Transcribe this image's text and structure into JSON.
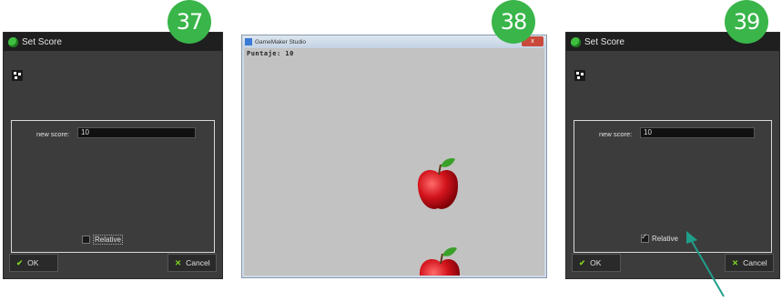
{
  "steps": [
    "37",
    "38",
    "39"
  ],
  "dialog_left": {
    "title": "Set Score",
    "new_score_label": "new score:",
    "new_score_value": "10",
    "relative_label": "Relative",
    "relative_checked": false,
    "ok_label": "OK",
    "cancel_label": "Cancel"
  },
  "game_window": {
    "title": "GameMaker Studio",
    "score_text": "Puntaje: 10",
    "close_glyph": "x"
  },
  "dialog_right": {
    "title": "Set Score",
    "new_score_label": "new score:",
    "new_score_value": "10",
    "relative_label": "Relative",
    "relative_checked": true,
    "ok_label": "OK",
    "cancel_label": "Cancel"
  },
  "colors": {
    "badge": "#39b54a",
    "arrow": "#1f9e8a",
    "dialog_bg": "#3c3c3c",
    "apple": "#c8141c"
  },
  "icons": [
    "game-maker-icon",
    "gear-icon",
    "checkmark-icon",
    "cross-icon",
    "apple-sprite",
    "arrow-pointer"
  ]
}
